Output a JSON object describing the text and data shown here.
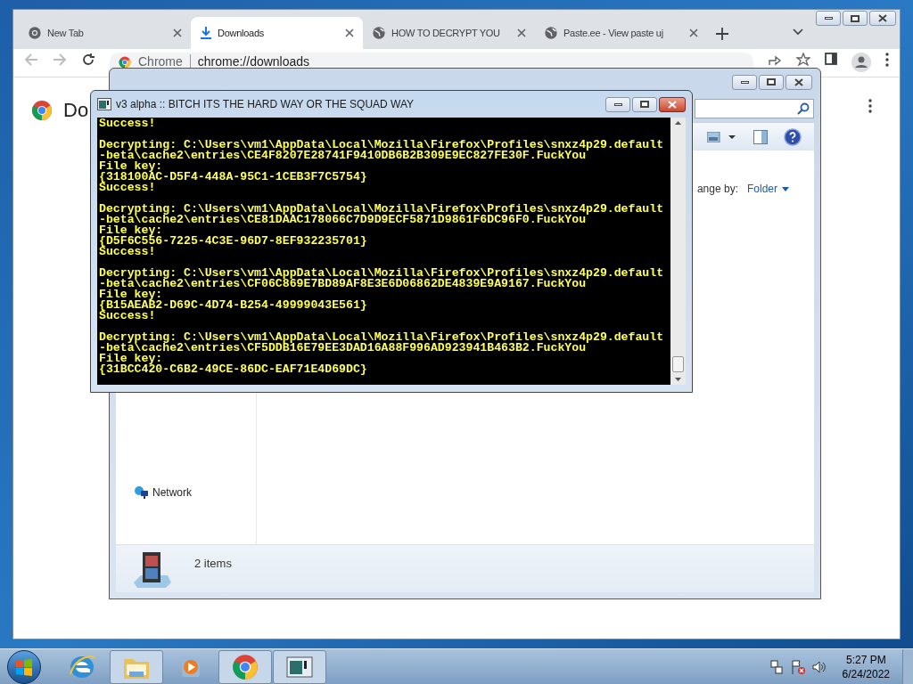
{
  "browser": {
    "tabs": [
      {
        "label": "New Tab",
        "selected": false,
        "kind": "chrome"
      },
      {
        "label": "Downloads",
        "selected": true,
        "kind": "download"
      },
      {
        "label": "HOW TO DECRYPT YOU",
        "selected": false,
        "kind": "globe"
      },
      {
        "label": "Paste.ee - View paste uj",
        "selected": false,
        "kind": "globe"
      }
    ],
    "address": {
      "chip": "Chrome",
      "url": "chrome://downloads"
    },
    "page_heading": "Do"
  },
  "explorer": {
    "arrange_label": "ange by:",
    "arrange_value": "Folder",
    "nav_item": "Network",
    "status": "2 items"
  },
  "console": {
    "title": "v3 alpha :: BITCH ITS THE HARD WAY OR THE SQUAD WAY",
    "groups": [
      [
        "Success!"
      ],
      [
        "Decrypting: C:\\Users\\vm1\\AppData\\Local\\Mozilla\\Firefox\\Profiles\\snxz4p29.default",
        "-beta\\cache2\\entries\\CE4F8207E28741F9410DB6B2B309E9EC827FE30F.FuckYou",
        "File key:",
        "{318100AC-D5F4-448A-95C1-1CEB3F7C5754}",
        "Success!"
      ],
      [
        "Decrypting: C:\\Users\\vm1\\AppData\\Local\\Mozilla\\Firefox\\Profiles\\snxz4p29.default",
        "-beta\\cache2\\entries\\CE81DAAC178066C7D9D9ECF5871D9861F6DC96F0.FuckYou",
        "File key:",
        "{D5F6C556-7225-4C3E-96D7-8EF932235701}",
        "Success!"
      ],
      [
        "Decrypting: C:\\Users\\vm1\\AppData\\Local\\Mozilla\\Firefox\\Profiles\\snxz4p29.default",
        "-beta\\cache2\\entries\\CF06C869E7BD89AF8E3E6D06862DE4839E9A9167.FuckYou",
        "File key:",
        "{B15AEAB2-D69C-4D74-B254-49999043E561}",
        "Success!"
      ],
      [
        "Decrypting: C:\\Users\\vm1\\AppData\\Local\\Mozilla\\Firefox\\Profiles\\snxz4p29.default",
        "-beta\\cache2\\entries\\CF5DDB16E79EE3DAD16A88F996AD923941B463B2.FuckYou",
        "File key:",
        "{31BCC420-C6B2-49CE-86DC-EAF71E4D69DC}"
      ]
    ]
  },
  "taskbar": {
    "apps": [
      {
        "kind": "ie",
        "selected": false
      },
      {
        "kind": "folder",
        "selected": true
      },
      {
        "kind": "media",
        "selected": false
      },
      {
        "kind": "chrome",
        "selected": true
      },
      {
        "kind": "console",
        "selected": true
      }
    ],
    "time": "5:27 PM",
    "date": "6/24/2022"
  }
}
